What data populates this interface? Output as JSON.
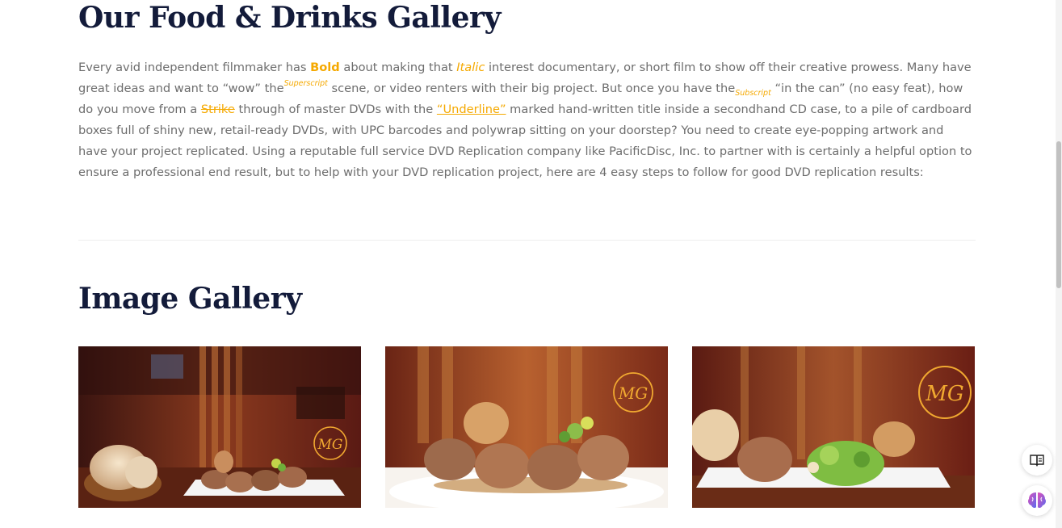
{
  "gallery_heading": "Our Food & Drinks Gallery",
  "intro": {
    "p1": "Every avid independent filmmaker has ",
    "bold": "Bold",
    "p2": " about making that ",
    "italic": "Italic",
    "p3": " interest documentary, or short film to show off their creative prowess. Many have great ideas and want to “wow” the",
    "superscript": "Superscript",
    "p4": " scene, or video renters with their big project. But once you have the",
    "subscript": "Subscript",
    "p5": " “in the can” (no easy feat), how do you move from a ",
    "strike": "Strike",
    "p6": " through of master DVDs with the ",
    "underline": "“Underline”",
    "p7": " marked hand-written title inside a secondhand CD case, to a pile of cardboard boxes full of shiny new, retail-ready DVDs, with UPC barcodes and polywrap sitting on your doorstep? You need to create eye-popping artwork and have your project replicated. Using a reputable full service DVD Replication company like PacificDisc, Inc. to partner with is certainly a helpful option to ensure a professional end result, but to help with your DVD replication project, here are 4 easy steps to follow for good DVD replication results:"
  },
  "image_gallery_heading": "Image Gallery",
  "images": [
    {
      "logo": "MG"
    },
    {
      "logo": "MG"
    },
    {
      "logo": "MG"
    }
  ],
  "floating_buttons": [
    "reader-mode-icon",
    "ai-brain-icon"
  ],
  "colors": {
    "heading": "#131b3a",
    "accent": "#f5a901",
    "body_text": "#6d6d6d"
  }
}
